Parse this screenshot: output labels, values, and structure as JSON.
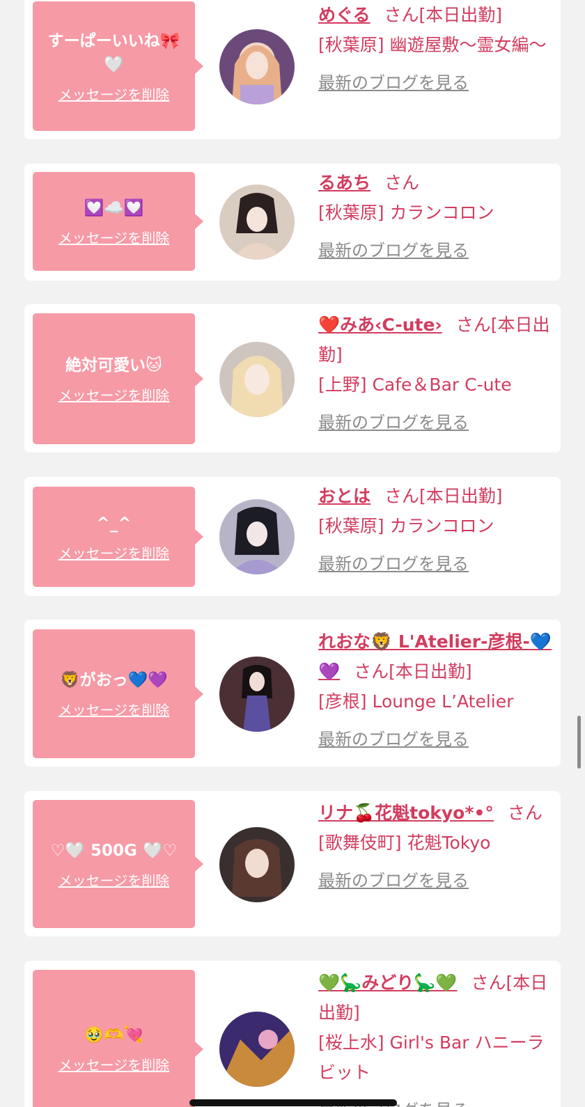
{
  "colors": {
    "background": "#f2f2f2",
    "card": "#ffffff",
    "bubble": "#f69aa6",
    "accent": "#d23c5e",
    "muted": "#8a8a8a"
  },
  "items": [
    {
      "message": "すーぱーいいね🎀🤍",
      "delete_label": "メッセージを削除",
      "name": "めぐる",
      "san": "さん",
      "status": "[本日出勤]",
      "area": "[秋葉原] 幽遊屋敷〜霊女編〜",
      "blog_label": "最新のブログを見る"
    },
    {
      "message": "💟☁️💟",
      "delete_label": "メッセージを削除",
      "name": "るあち",
      "san": "さん",
      "status": "",
      "area": "[秋葉原] カランコロン",
      "blog_label": "最新のブログを見る"
    },
    {
      "message": "絶対可愛い🐱",
      "delete_label": "メッセージを削除",
      "name": "❤️みあ‹C-ute›",
      "san": "さん",
      "status": "[本日出勤]",
      "area": "[上野] Cafe＆Bar C-ute",
      "blog_label": "最新のブログを見る"
    },
    {
      "message": "^_^",
      "delete_label": "メッセージを削除",
      "name": "おとは",
      "san": "さん",
      "status": "[本日出勤]",
      "area": "[秋葉原] カランコロン",
      "blog_label": "最新のブログを見る"
    },
    {
      "message": "🦁がおっ💙💜",
      "delete_label": "メッセージを削除",
      "name": "れおな🦁 L'Atelier-彦根-💙💜",
      "san": "さん",
      "status": "[本日出勤]",
      "area": "[彦根] Lounge L’Atelier",
      "blog_label": "最新のブログを見る"
    },
    {
      "message": "♡🤍 500G 🤍♡",
      "delete_label": "メッセージを削除",
      "name": "リナ🍒花魁tokyo*•°",
      "san": "さん",
      "status": "",
      "area": "[歌舞伎町] 花魁Tokyo",
      "blog_label": "最新のブログを見る"
    },
    {
      "message": "🥹🫶💘",
      "delete_label": "メッセージを削除",
      "name": "💚🦕みどり🦕💚",
      "san": "さん",
      "status": "[本日出勤]",
      "area": "[桜上水] Girl's Bar ハニーラビット",
      "blog_label": "最新のブログを見る"
    }
  ]
}
